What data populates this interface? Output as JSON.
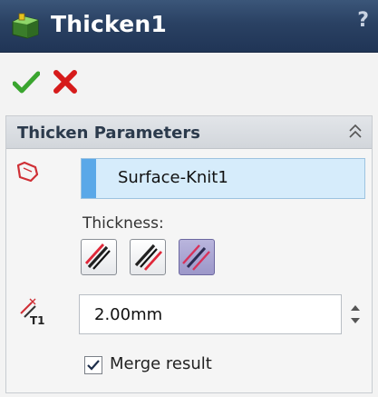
{
  "feature": {
    "title": "Thicken1",
    "help_icon": "?",
    "icon": "thicken-feature-icon"
  },
  "actions": {
    "ok_icon": "checkmark-icon",
    "cancel_icon": "x-icon",
    "ok_color": "#3aa52f",
    "cancel_color": "#d61b1b"
  },
  "thicken_parameters": {
    "header": "Thicken Parameters",
    "selected_surface": "Surface-Knit1",
    "thickness_label": "Thickness:",
    "thickness_sides": [
      {
        "name": "thicken-side-1",
        "active": false
      },
      {
        "name": "thicken-side-2",
        "active": false
      },
      {
        "name": "thicken-both-sides",
        "active": true
      }
    ],
    "thickness_icon_label": "T1",
    "thickness_value": "2.00mm",
    "merge_result_label": "Merge result",
    "merge_result_checked": true
  },
  "colors": {
    "title_bar": "#2a4163",
    "selection_bg": "#d6ecfb",
    "selection_marker": "#5aa8e8"
  }
}
